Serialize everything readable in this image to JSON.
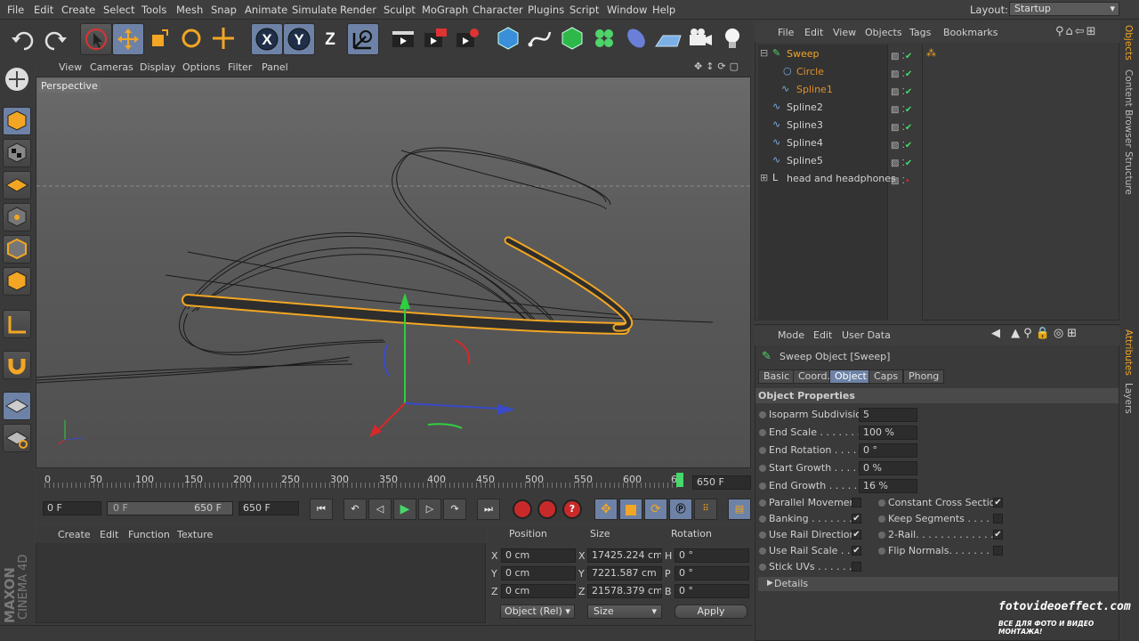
{
  "menubar": {
    "items": [
      "File",
      "Edit",
      "Create",
      "Select",
      "Tools",
      "Mesh",
      "Snap",
      "Animate",
      "Simulate",
      "Render",
      "Sculpt",
      "MoGraph",
      "Character",
      "Plugins",
      "Script",
      "Window",
      "Help"
    ],
    "layout_label": "Layout:",
    "layout_value": "Startup"
  },
  "toolbar": {
    "axis_labels": [
      "X",
      "Y",
      "Z"
    ]
  },
  "viewport": {
    "menu": [
      "View",
      "Cameras",
      "Display",
      "Options",
      "Filter",
      "Panel"
    ],
    "label": "Perspective"
  },
  "timeline": {
    "ticks": [
      "0",
      "50",
      "100",
      "150",
      "200",
      "250",
      "300",
      "350",
      "400",
      "450",
      "500",
      "550",
      "600",
      "6"
    ],
    "end_frame": "650 F",
    "current_frame": "0 F",
    "range_start": "0 F",
    "range_end": "650 F",
    "max_frame": "650 F"
  },
  "materials": {
    "menu": [
      "Create",
      "Edit",
      "Function",
      "Texture"
    ]
  },
  "coords": {
    "headers": [
      "Position",
      "Size",
      "Rotation"
    ],
    "rows": [
      {
        "axis": "X",
        "pos": "0 cm",
        "size_axis": "X",
        "size": "17425.224 cm",
        "rot_axis": "H",
        "rot": "0 °"
      },
      {
        "axis": "Y",
        "pos": "0 cm",
        "size_axis": "Y",
        "size": "7221.587 cm",
        "rot_axis": "P",
        "rot": "0 °"
      },
      {
        "axis": "Z",
        "pos": "0 cm",
        "size_axis": "Z",
        "size": "21578.379 cm",
        "rot_axis": "B",
        "rot": "0 °"
      }
    ],
    "mode": "Object (Rel)",
    "size_mode": "Size",
    "apply": "Apply"
  },
  "objects": {
    "menu": [
      "File",
      "Edit",
      "View",
      "Objects",
      "Tags",
      "Bookmarks"
    ],
    "items": [
      {
        "name": "Sweep",
        "color": "#f2a623"
      },
      {
        "name": "Circle",
        "color": "#e0902a"
      },
      {
        "name": "Spline1",
        "color": "#e0902a"
      },
      {
        "name": "Spline2",
        "color": "#d0d0d0"
      },
      {
        "name": "Spline3",
        "color": "#d0d0d0"
      },
      {
        "name": "Spline4",
        "color": "#d0d0d0"
      },
      {
        "name": "Spline5",
        "color": "#d0d0d0"
      },
      {
        "name": "head and headphones",
        "color": "#d0d0d0"
      }
    ]
  },
  "side_tabs": {
    "objects": "Objects",
    "content_browser": "Content Browser",
    "structure": "Structure",
    "attributes": "Attributes",
    "layers": "Layers"
  },
  "attributes": {
    "menu": [
      "Mode",
      "Edit",
      "User Data"
    ],
    "object_title": "Sweep Object [Sweep]",
    "tabs": [
      "Basic",
      "Coord.",
      "Object",
      "Caps",
      "Phong"
    ],
    "active_tab": "Object",
    "section": "Object Properties",
    "fields": [
      {
        "label": "Isoparm Subdivision",
        "value": "5"
      },
      {
        "label": "End Scale . . . . . . . .",
        "value": "100 %"
      },
      {
        "label": "End Rotation . . . . .",
        "value": "0 °"
      },
      {
        "label": "Start Growth . . . . .",
        "value": "0 %"
      },
      {
        "label": "End Growth . . . . . .",
        "value": "16 %"
      }
    ],
    "checks_left": [
      {
        "label": "Parallel Movement",
        "checked": ""
      },
      {
        "label": "Banking . . . . . . . .",
        "checked": "✔"
      },
      {
        "label": "Use Rail Direction",
        "checked": "✔"
      },
      {
        "label": "Use Rail Scale . . .",
        "checked": "✔"
      },
      {
        "label": "Stick UVs . . . . . .",
        "checked": ""
      }
    ],
    "checks_right": [
      {
        "label": "Constant Cross Section",
        "checked": "✔"
      },
      {
        "label": "Keep Segments . . . . .",
        "checked": ""
      },
      {
        "label": "2-Rail. . . . . . . . . . . . .",
        "checked": "✔"
      },
      {
        "label": "Flip Normals. . . . . . . .",
        "checked": ""
      }
    ],
    "details": "Details"
  },
  "branding": {
    "maxon": "MAXON",
    "cinema": "CINEMA 4D",
    "watermark": "fotovideoeffect.com",
    "watermark_sub": "ВСЕ ДЛЯ ФОТО И ВИДЕО МОНТАЖА!"
  },
  "colors": {
    "accent_orange": "#f2a623",
    "axis_green": "#2fcf3f",
    "axis_red": "#d8282a",
    "axis_blue": "#3a4ac8",
    "active_tab": "#6d82a6"
  }
}
